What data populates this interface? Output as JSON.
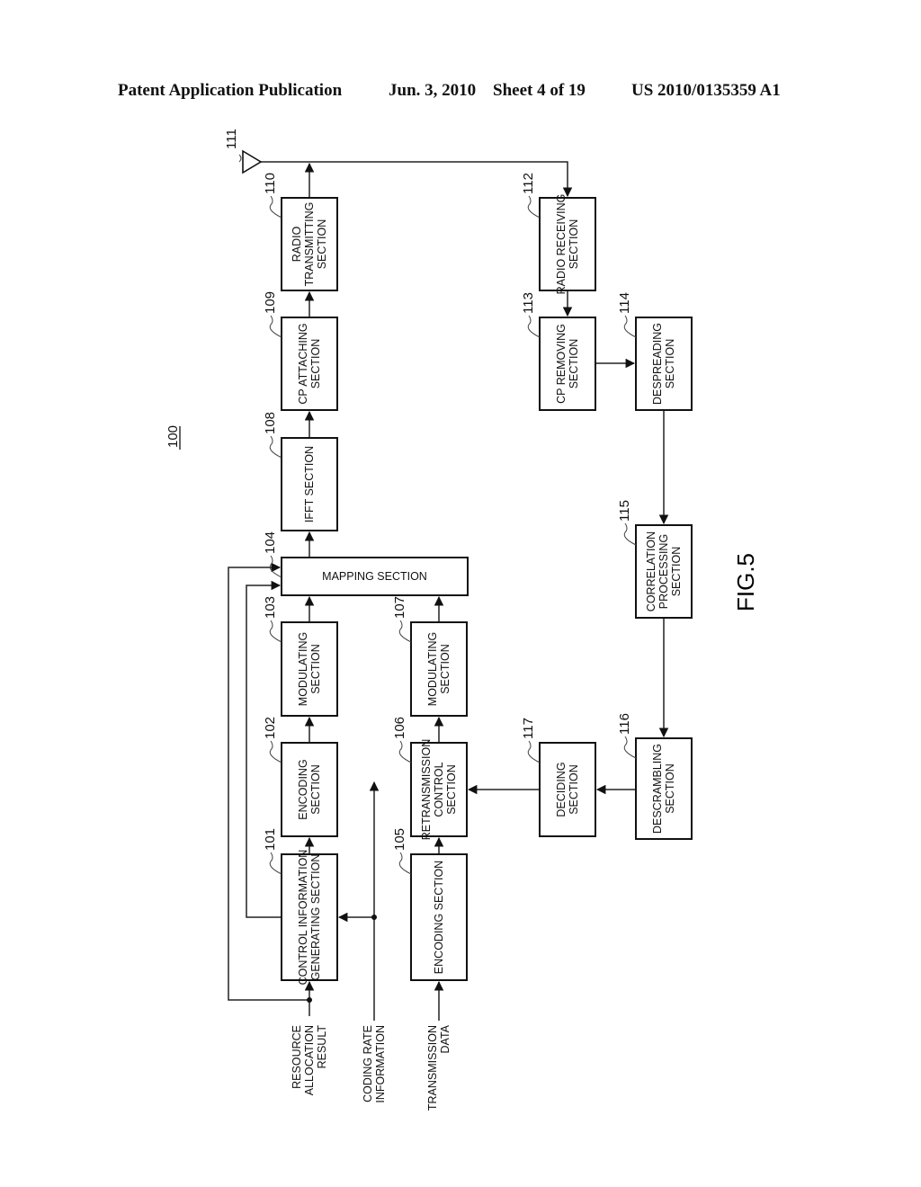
{
  "header": {
    "left": "Patent Application Publication",
    "date": "Jun. 3, 2010",
    "sheet": "Sheet 4 of 19",
    "number": "US 2010/0135359 A1"
  },
  "figure": {
    "label": "FIG.5",
    "device_ref": "100"
  },
  "blocks": [
    {
      "id": "101",
      "lines": [
        "CONTROL INFORMATION",
        "GENERATING SECTION"
      ]
    },
    {
      "id": "102",
      "lines": [
        "ENCODING",
        "SECTION"
      ]
    },
    {
      "id": "103",
      "lines": [
        "MODULATING",
        "SECTION"
      ]
    },
    {
      "id": "104",
      "lines": [
        "MAPPING SECTION"
      ]
    },
    {
      "id": "105",
      "lines": [
        "ENCODING SECTION"
      ]
    },
    {
      "id": "106",
      "lines": [
        "RETRANSMISSION",
        "CONTROL",
        "SECTION"
      ]
    },
    {
      "id": "107",
      "lines": [
        "MODULATING",
        "SECTION"
      ]
    },
    {
      "id": "108",
      "lines": [
        "IFFT SECTION"
      ]
    },
    {
      "id": "109",
      "lines": [
        "CP ATTACHING",
        "SECTION"
      ]
    },
    {
      "id": "110",
      "lines": [
        "RADIO",
        "TRANSMITTING",
        "SECTION"
      ]
    },
    {
      "id": "111",
      "lines": []
    },
    {
      "id": "112",
      "lines": [
        "RADIO RECEIVING",
        "SECTION"
      ]
    },
    {
      "id": "113",
      "lines": [
        "CP REMOVING",
        "SECTION"
      ]
    },
    {
      "id": "114",
      "lines": [
        "DESPREADING",
        "SECTION"
      ]
    },
    {
      "id": "115",
      "lines": [
        "CORRELATION",
        "PROCESSING",
        "SECTION"
      ]
    },
    {
      "id": "116",
      "lines": [
        "DESCRAMBLING",
        "SECTION"
      ]
    },
    {
      "id": "117",
      "lines": [
        "DECIDING",
        "SECTION"
      ]
    }
  ],
  "inputs": [
    {
      "name": "resource-allocation-result",
      "lines": [
        "RESOURCE",
        "ALLOCATION",
        "RESULT"
      ]
    },
    {
      "name": "coding-rate-information",
      "lines": [
        "CODING RATE",
        "INFORMATION"
      ]
    },
    {
      "name": "transmission-data",
      "lines": [
        "TRANSMISSION",
        "DATA"
      ]
    }
  ]
}
